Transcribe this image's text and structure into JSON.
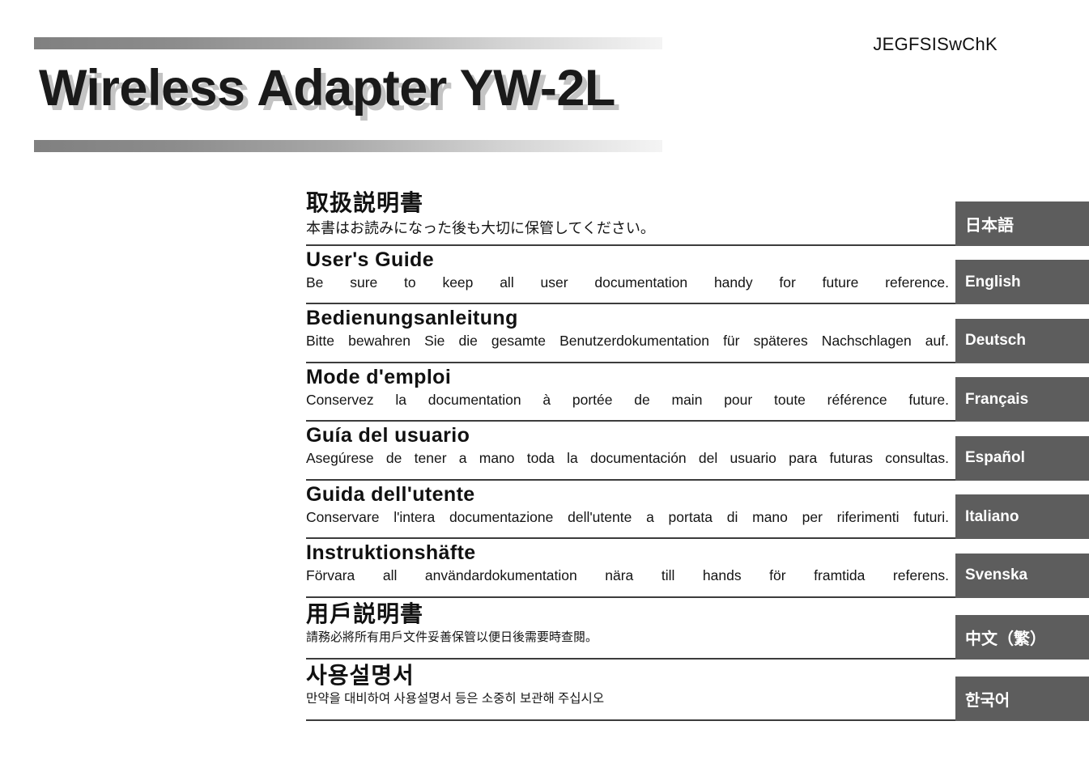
{
  "header": {
    "code": "JEGFSISwChK"
  },
  "title": {
    "text": "Wireless Adapter YW-2L"
  },
  "colors": {
    "tab_background": "#5d5d5d",
    "tab_text": "#ffffff",
    "rule": "#3c3c3c",
    "title_text": "#1a1a1a",
    "title_shadow": "#c4c4c4",
    "bar_gradient_start": "#808080",
    "bar_gradient_end": "#f4f4f4"
  },
  "languages": [
    {
      "heading": "取扱説明書",
      "subtitle": "本書はお読みになった後も大切に保管してください。",
      "tab": "日本語",
      "script": "cjk"
    },
    {
      "heading": "User's Guide",
      "subtitle": "Be sure to keep all user documentation handy for future reference.",
      "tab": "English",
      "script": "latin"
    },
    {
      "heading": "Bedienungsanleitung",
      "subtitle": "Bitte bewahren Sie die gesamte Benutzerdokumentation für späteres Nachschlagen auf.",
      "tab": "Deutsch",
      "script": "latin"
    },
    {
      "heading": "Mode d'emploi",
      "subtitle": "Conservez la documentation à portée de main pour toute référence future.",
      "tab": "Français",
      "script": "latin"
    },
    {
      "heading": "Guía del usuario",
      "subtitle": "Asegúrese de tener a mano toda la documentación del usuario para futuras consultas.",
      "tab": "Español",
      "script": "latin"
    },
    {
      "heading": "Guida dell'utente",
      "subtitle": "Conservare l'intera documentazione dell'utente a portata di mano per riferimenti futuri.",
      "tab": "Italiano",
      "script": "latin"
    },
    {
      "heading": "Instruktionshäfte",
      "subtitle": "Förvara all användardokumentation nära till hands för framtida referens.",
      "tab": "Svenska",
      "script": "latin"
    },
    {
      "heading": "用戶説明書",
      "subtitle": "請務必將所有用戶文件妥善保管以便日後需要時查閱。",
      "tab": "中文（繁）",
      "script": "cjk"
    },
    {
      "heading": "사용설명서",
      "subtitle": "만약을 대비하여 사용설명서 등은 소중히 보관해 주십시오",
      "tab": "한국어",
      "script": "cjk"
    }
  ]
}
